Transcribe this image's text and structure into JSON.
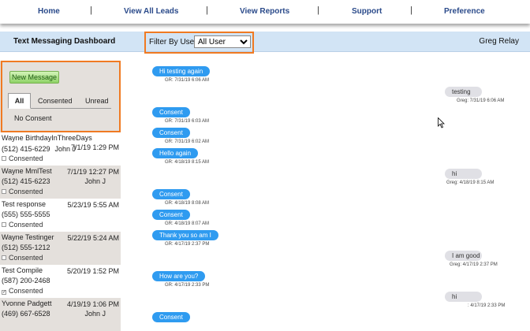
{
  "nav": {
    "home": "Home",
    "view_all_leads": "View All Leads",
    "view_reports": "View Reports",
    "support": "Support",
    "preference": "Preference",
    "separator": "|"
  },
  "header": {
    "title": "Text Messaging Dashboard",
    "filter_label": "Filter By User:",
    "filter_value": "All User",
    "user_name": "Greg Relay"
  },
  "filters": {
    "new_message": "New Message",
    "tabs": [
      "All",
      "Consented",
      "Unread",
      "No Consent"
    ]
  },
  "leads": [
    {
      "name": "Wayne BirthdayInThreeDays",
      "time": "7/1/19 1:29 PM",
      "phone": "(512) 415-6229",
      "agent": "John J",
      "consent": "Consented",
      "checked": false
    },
    {
      "name": "Wayne MmlTest",
      "time": "7/1/19 12:27 PM",
      "phone": "(512) 415-6223",
      "agent": "John J",
      "consent": "Consented",
      "checked": false
    },
    {
      "name": "Test response",
      "time": "5/23/19 5:55 AM",
      "phone": "(555) 555-5555",
      "agent": "",
      "consent": "Consented",
      "checked": false
    },
    {
      "name": "Wayne Testinger",
      "time": "5/22/19 5:24 AM",
      "phone": "(512) 555-1212",
      "agent": "",
      "consent": "Consented",
      "checked": false
    },
    {
      "name": "Test Compile",
      "time": "5/20/19 1:52 PM",
      "phone": "(587) 200-2468",
      "agent": "",
      "consent": "Consented",
      "checked": true
    },
    {
      "name": "Yvonne Padgett",
      "time": "4/19/19 1:06 PM",
      "phone": "(469) 667-6528",
      "agent": "John J",
      "consent": "",
      "checked": false
    }
  ],
  "messages": [
    {
      "dir": "out",
      "text": "Hi testing again",
      "meta": "GR: 7/31/19 6:06 AM"
    },
    {
      "dir": "in",
      "text": "testing",
      "meta": "Greg: 7/31/19 6:06 AM"
    },
    {
      "dir": "out",
      "text": "Consent",
      "meta": "GR: 7/31/19 6:03 AM"
    },
    {
      "dir": "out",
      "text": "Consent",
      "meta": "GR: 7/31/19 6:02 AM"
    },
    {
      "dir": "out",
      "text": "Hello again",
      "meta": "GR: 4/18/19 8:15 AM"
    },
    {
      "dir": "in",
      "text": "hi",
      "meta": "Greg: 4/18/19 8:15 AM"
    },
    {
      "dir": "out",
      "text": "Consent",
      "meta": "GR: 4/18/19 8:08 AM"
    },
    {
      "dir": "out",
      "text": "Consent",
      "meta": "GR: 4/18/19 8:07 AM"
    },
    {
      "dir": "out",
      "text": "Thank you so am I",
      "meta": "GR: 4/17/19 2:37 PM"
    },
    {
      "dir": "in",
      "text": "I am good",
      "meta": "Greg: 4/17/19 2:37 PM"
    },
    {
      "dir": "out",
      "text": "How are you?",
      "meta": "GR: 4/17/19 2:33 PM"
    },
    {
      "dir": "in",
      "text": "hi",
      "meta": ": 4/17/19 2:33 PM"
    },
    {
      "dir": "out",
      "text": "Consent",
      "meta": ""
    }
  ],
  "colors": {
    "accent_orange": "#f07a22",
    "bubble_blue": "#2f9bf0",
    "bubble_gray": "#e0e0e5",
    "header_bar": "#d2e4f5"
  }
}
